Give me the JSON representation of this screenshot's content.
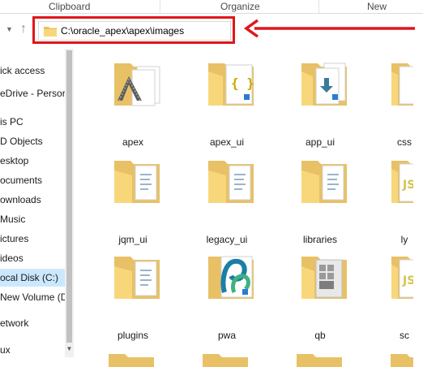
{
  "ribbon": {
    "groups": [
      "Clipboard",
      "Organize",
      "New"
    ]
  },
  "address_bar": {
    "path": "C:\\oracle_apex\\apex\\images"
  },
  "sidebar": {
    "items": [
      {
        "label": "ick access"
      },
      {
        "label": "eDrive - Persor"
      },
      {
        "label": "is PC"
      },
      {
        "label": "D Objects"
      },
      {
        "label": "esktop"
      },
      {
        "label": "ocuments"
      },
      {
        "label": "ownloads"
      },
      {
        "label": "Music"
      },
      {
        "label": "ictures"
      },
      {
        "label": "ideos"
      },
      {
        "label": "ocal Disk (C:)"
      },
      {
        "label": "New Volume (D:"
      },
      {
        "label": "etwork"
      },
      {
        "label": "ux"
      }
    ],
    "selected_label": "ocal Disk (C:)"
  },
  "folders": [
    {
      "name": "apex",
      "overlay": "apex-logo-icon"
    },
    {
      "name": "apex_ui",
      "overlay": "json-braces-icon"
    },
    {
      "name": "app_ui",
      "overlay": "download-arrow-icon"
    },
    {
      "name": "css",
      "overlay": "document-icon"
    },
    {
      "name": "jqm_ui",
      "overlay": "document-icon"
    },
    {
      "name": "legacy_ui",
      "overlay": "document-icon"
    },
    {
      "name": "libraries",
      "overlay": "document-icon"
    },
    {
      "name": "ly",
      "overlay": "js-icon"
    },
    {
      "name": "plugins",
      "overlay": "document-icon"
    },
    {
      "name": "pwa",
      "overlay": "pwa-logo-icon"
    },
    {
      "name": "qb",
      "overlay": "grid-icon"
    },
    {
      "name": "sc",
      "overlay": "js-icon"
    }
  ],
  "colors": {
    "folder_back": "#e8c166",
    "folder_front": "#f8d77b",
    "highlight_red": "#e0161b",
    "selection": "#cce8ff",
    "vscode_blue": "#2a7bd4"
  }
}
